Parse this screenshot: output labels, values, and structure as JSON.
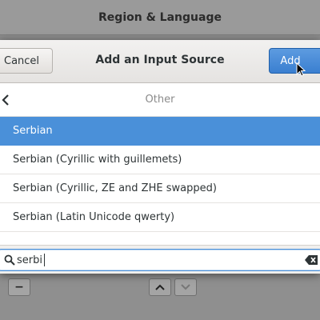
{
  "background_window": {
    "title": "Region & Language",
    "remove_label": "−",
    "up_label": "^",
    "down_label": "v"
  },
  "dialog": {
    "title": "Add an Input Source",
    "cancel_label": "Cancel",
    "add_label": "Add",
    "nav": {
      "back_icon": "chevron-left-icon",
      "label": "Other"
    },
    "items": [
      {
        "label": "Serbian",
        "selected": true
      },
      {
        "label": "Serbian (Cyrillic with guillemets)",
        "selected": false
      },
      {
        "label": "Serbian (Cyrillic, ZE and ZHE swapped)",
        "selected": false
      },
      {
        "label": "Serbian (Latin Unicode qwerty)",
        "selected": false
      }
    ],
    "search": {
      "value": "serbi",
      "icon": "search-icon",
      "clear_icon": "clear-icon"
    }
  },
  "colors": {
    "accent": "#4a90d9",
    "add_button": "#3a7fd0"
  }
}
